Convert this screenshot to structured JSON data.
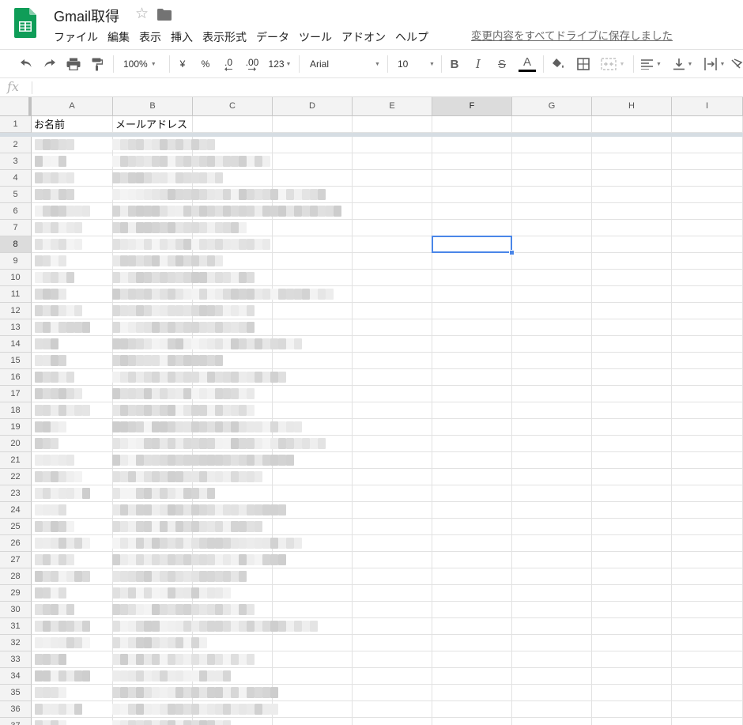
{
  "app": {
    "title": "Gmail取得",
    "save_status": "変更内容をすべてドライブに保存しました",
    "accent": "#0f9d58"
  },
  "menu": [
    "ファイル",
    "編集",
    "表示",
    "挿入",
    "表示形式",
    "データ",
    "ツール",
    "アドオン",
    "ヘルプ"
  ],
  "toolbar": {
    "zoom": "100%",
    "currency": "¥",
    "percent": "%",
    "decrease_decimal": ".0",
    "increase_decimal": ".00",
    "number_format": "123",
    "font": "Arial",
    "font_size": "10",
    "bold": "B",
    "italic": "I",
    "strikethrough": "S",
    "text_color_glyph": "A",
    "text_color": "#000000",
    "icons": [
      "undo-icon",
      "redo-icon",
      "print-icon",
      "paint-format-icon",
      "fill-color-icon",
      "borders-icon",
      "merge-cells-icon",
      "horizontal-align-icon",
      "vertical-align-icon",
      "text-wrap-icon",
      "text-rotation-icon"
    ]
  },
  "formula_bar": {
    "label": "fx",
    "value": ""
  },
  "sheet": {
    "columns": [
      "A",
      "B",
      "C",
      "D",
      "E",
      "F",
      "G",
      "H",
      "I"
    ],
    "rows": [
      "1",
      "2",
      "3",
      "4",
      "5",
      "6",
      "7",
      "8",
      "9",
      "10",
      "11",
      "12",
      "13",
      "14",
      "15",
      "16",
      "17",
      "18",
      "19",
      "20",
      "21",
      "22",
      "23",
      "24",
      "25",
      "26",
      "27",
      "28",
      "29",
      "30",
      "31",
      "32",
      "33",
      "34",
      "35",
      "36",
      "37"
    ],
    "selected_column": "F",
    "selected_row": "8",
    "selected_cell": "F8",
    "header_row": {
      "A": "お名前",
      "B": "メールアドレス"
    }
  }
}
